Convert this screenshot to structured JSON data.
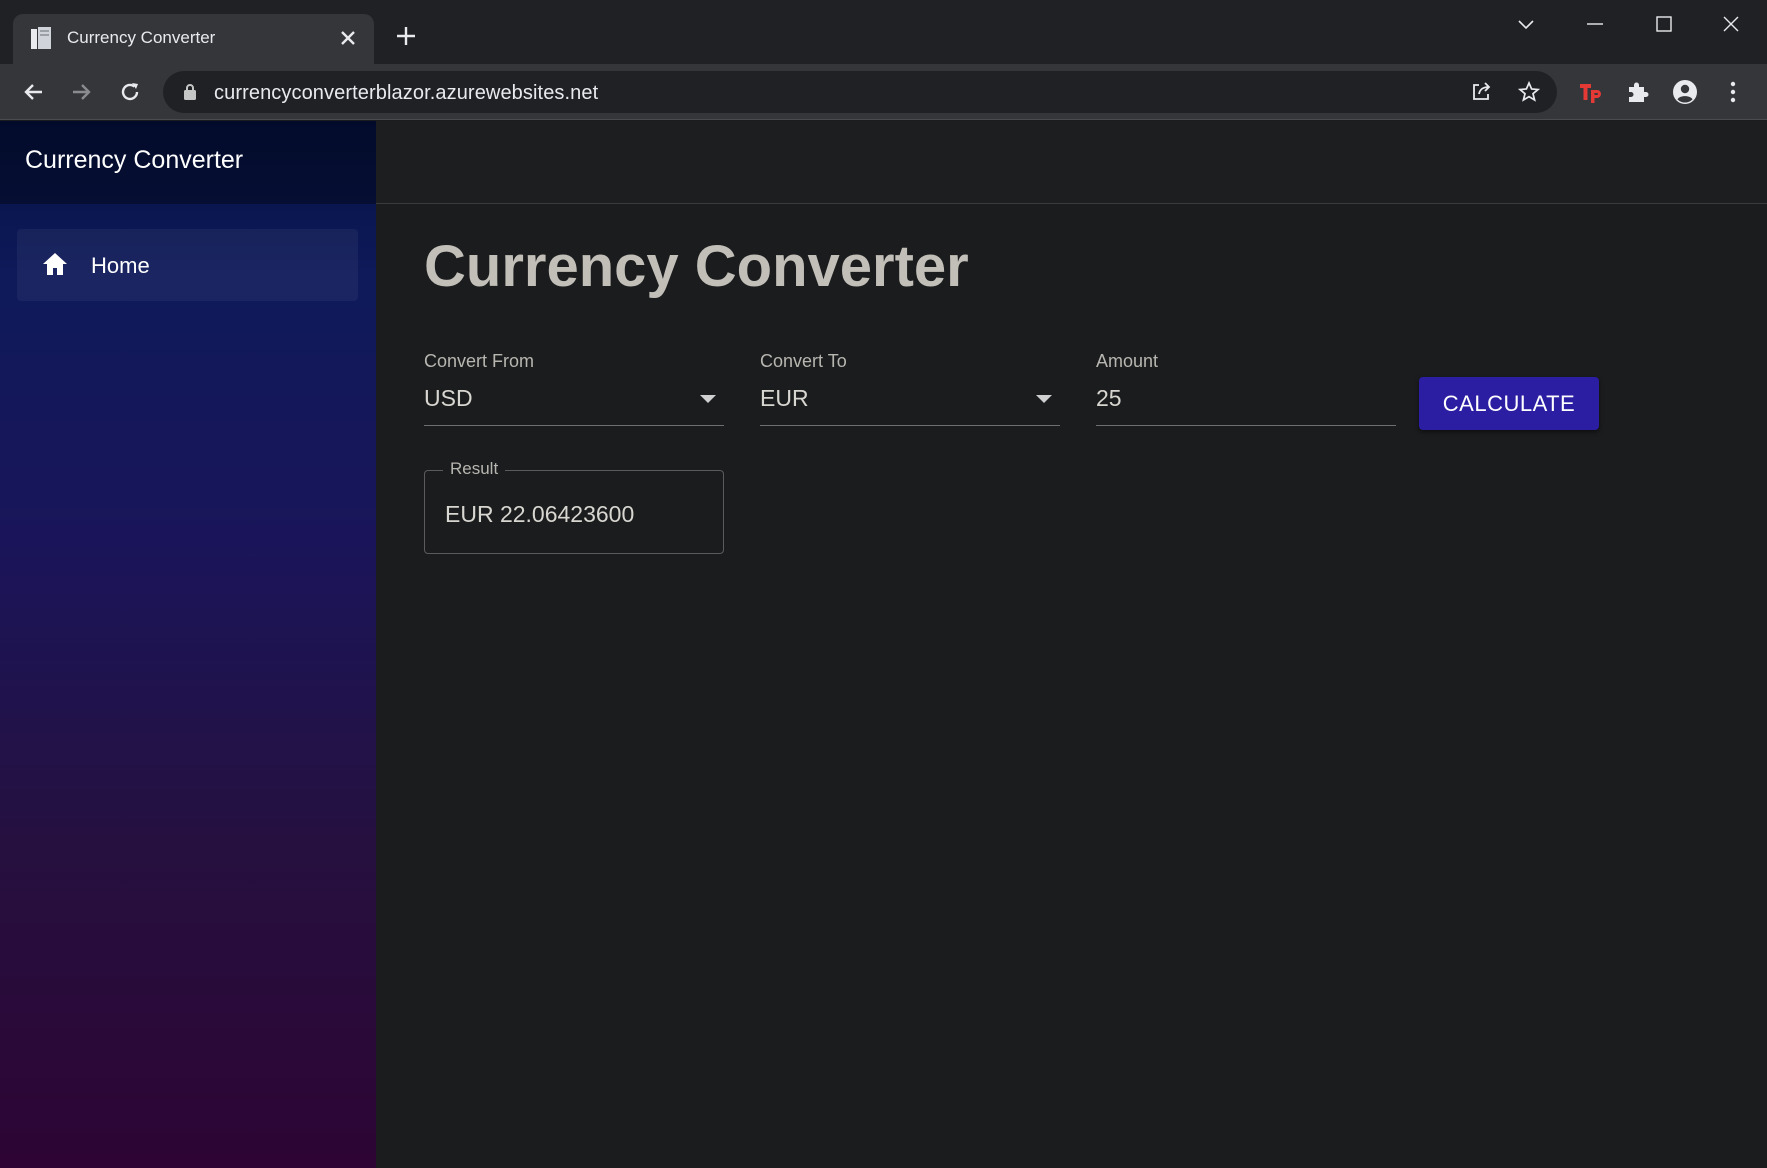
{
  "browser": {
    "tab_title": "Currency Converter",
    "url": "currencyconverterblazor.azurewebsites.net"
  },
  "sidebar": {
    "brand": "Currency Converter",
    "items": [
      {
        "label": "Home",
        "icon": "home-icon"
      }
    ]
  },
  "main": {
    "title": "Currency Converter",
    "convert_from": {
      "label": "Convert From",
      "value": "USD"
    },
    "convert_to": {
      "label": "Convert To",
      "value": "EUR"
    },
    "amount": {
      "label": "Amount",
      "value": "25"
    },
    "calculate_label": "CALCULATE",
    "result": {
      "label": "Result",
      "value": "EUR 22.06423600"
    }
  },
  "colors": {
    "accent": "#2b1ea3",
    "sidebar_top": "#051243",
    "sidebar_bottom": "#2d0434",
    "background": "#1b1c1e"
  }
}
